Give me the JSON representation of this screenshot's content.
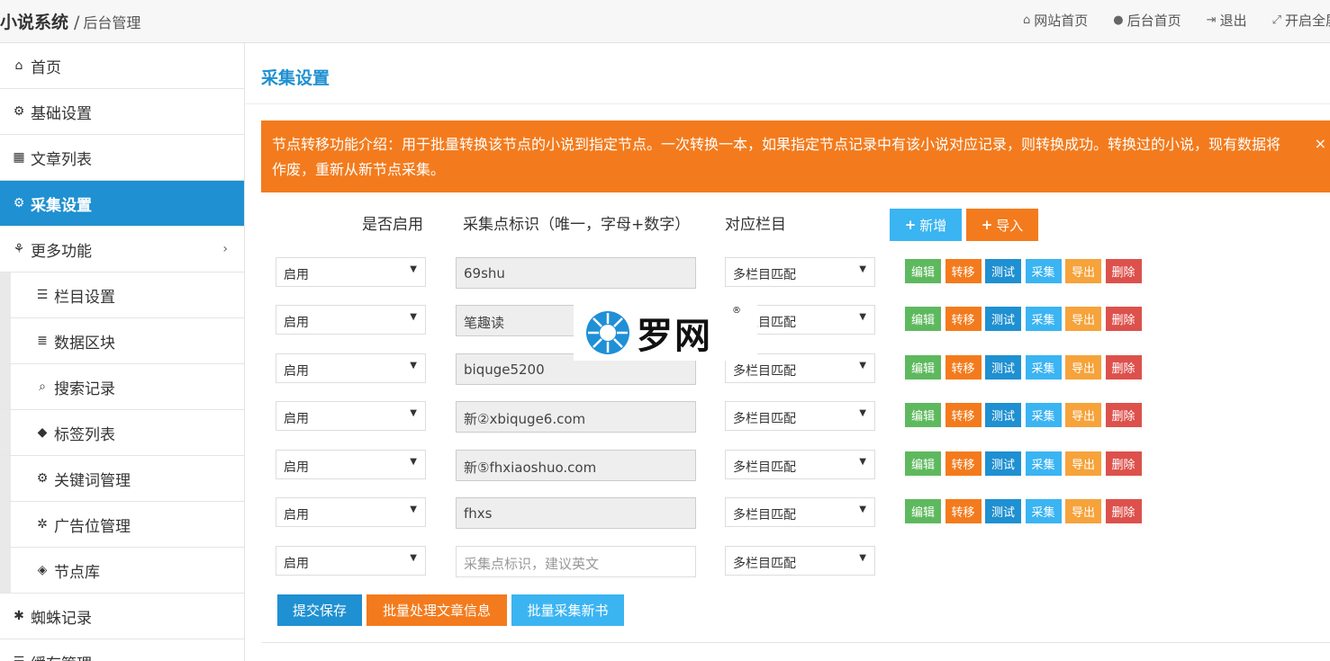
{
  "header": {
    "brand": "小说系统",
    "separator": "/",
    "subtitle": "后台管理",
    "links": [
      {
        "icon": "home-icon",
        "glyph": "⌂",
        "label": "网站首页"
      },
      {
        "icon": "user-icon",
        "glyph": "●",
        "label": "后台首页"
      },
      {
        "icon": "logout-icon",
        "glyph": "⇥",
        "label": "退出"
      },
      {
        "icon": "fullscreen-icon",
        "glyph": "⤢",
        "label": "开启全屏"
      }
    ]
  },
  "sidebar": {
    "items": [
      {
        "icon": "home-icon",
        "glyph": "⌂",
        "label": "首页"
      },
      {
        "icon": "gear-icon",
        "glyph": "⚙",
        "label": "基础设置"
      },
      {
        "icon": "table-icon",
        "glyph": "▦",
        "label": "文章列表"
      },
      {
        "icon": "gears-icon",
        "glyph": "⚙",
        "label": "采集设置"
      },
      {
        "icon": "sitemap-icon",
        "glyph": "⚘",
        "label": "更多功能"
      },
      {
        "icon": "list-icon",
        "glyph": "☰",
        "label": "栏目设置"
      },
      {
        "icon": "database-icon",
        "glyph": "≣",
        "label": "数据区块"
      },
      {
        "icon": "search-icon",
        "glyph": "⌕",
        "label": "搜索记录"
      },
      {
        "icon": "tag-icon",
        "glyph": "◆",
        "label": "标签列表"
      },
      {
        "icon": "gears-icon",
        "glyph": "⚙",
        "label": "关键词管理"
      },
      {
        "icon": "yelp-icon",
        "glyph": "✲",
        "label": "广告位管理"
      },
      {
        "icon": "cube-icon",
        "glyph": "◈",
        "label": "节点库"
      },
      {
        "icon": "bug-icon",
        "glyph": "✱",
        "label": "蜘蛛记录"
      },
      {
        "icon": "list-icon",
        "glyph": "☰",
        "label": "缓存管理"
      }
    ],
    "active_index": 3
  },
  "main": {
    "title": "采集设置",
    "alert": {
      "text": "节点转移功能介绍：用于批量转换该节点的小说到指定节点。一次转换一本，如果指定节点记录中有该小说对应记录，则转换成功。转换过的小说，现有数据将作废，重新从新节点采集。",
      "close": "×"
    },
    "columns": {
      "enabled": "是否启用",
      "source_id": "采集点标识（唯一，字母+数字）",
      "category": "对应栏目"
    },
    "add_button": "新增",
    "import_button": "导入",
    "rows": [
      {
        "enabled": "启用",
        "source": "69shu",
        "category": "多栏目匹配"
      },
      {
        "enabled": "启用",
        "source": "笔趣读",
        "category": "多栏目匹配"
      },
      {
        "enabled": "启用",
        "source": "biquge5200",
        "category": "多栏目匹配"
      },
      {
        "enabled": "启用",
        "source": "新②xbiquge6.com",
        "category": "多栏目匹配"
      },
      {
        "enabled": "启用",
        "source": "新⑤fhxiaoshuo.com",
        "category": "多栏目匹配"
      },
      {
        "enabled": "启用",
        "source": "fhxs",
        "category": "多栏目匹配"
      }
    ],
    "row_actions": [
      "编辑",
      "转移",
      "测试",
      "采集",
      "导出",
      "删除"
    ],
    "new_row": {
      "enabled": "启用",
      "placeholder": "采集点标识，建议英文",
      "category": "多栏目匹配"
    },
    "footer_buttons": {
      "save": "提交保存",
      "batch_process": "批量处理文章信息",
      "batch_collect": "批量采集新书"
    }
  },
  "watermark": {
    "text": "罗网",
    "reg": "®"
  },
  "colors": {
    "primary": "#1f90d1",
    "orange": "#f37b1d",
    "light_blue": "#3bb4f2",
    "green": "#5eb95e",
    "yellow": "#f6a33b",
    "red": "#dd514c"
  }
}
